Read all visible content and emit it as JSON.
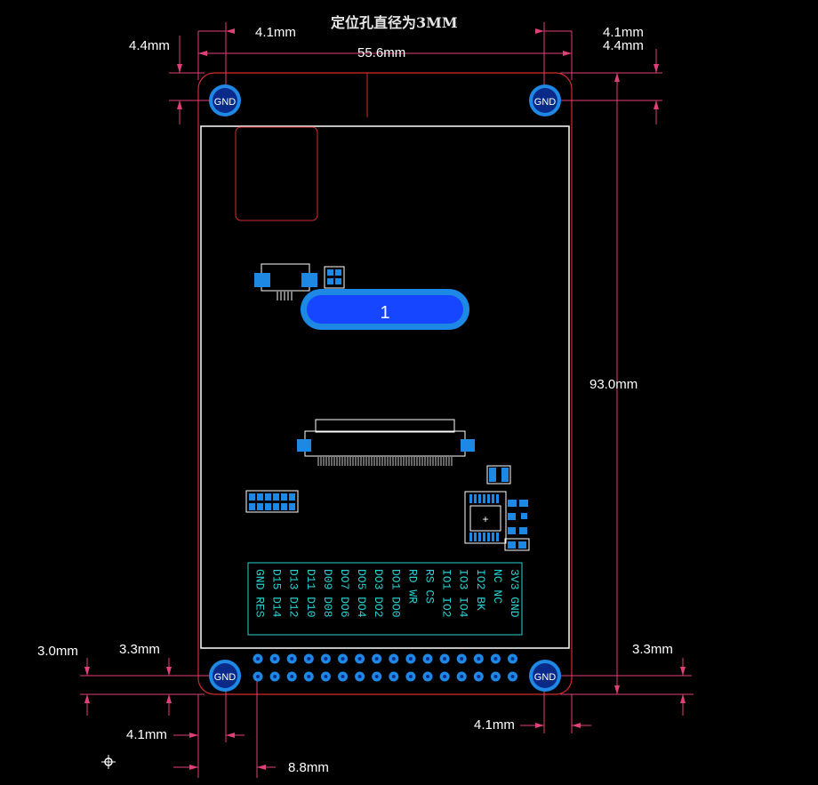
{
  "title": "定位孔直径为3MM",
  "dimensions": {
    "top_left_offset": "4.1mm",
    "top_left_height": "4.4mm",
    "width_total": "55.6mm",
    "top_right_offset": "4.1mm",
    "top_right_height": "4.4mm",
    "height_total": "93.0mm",
    "bottom_left_height": "3.0mm",
    "bottom_left_offset_y": "3.3mm",
    "bottom_right_offset_y": "3.3mm",
    "bottom_left_offset_x": "4.1mm",
    "bottom_right_offset_x": "4.1mm",
    "pin_offset": "8.8mm"
  },
  "mount_holes": [
    "GND",
    "GND",
    "GND",
    "GND"
  ],
  "connector_label": "1",
  "pin_labels": [
    "3V3 GND",
    "NC  NC",
    "IO2 BK",
    "IO3 IO4",
    "IO1 IO2",
    "RS  CS",
    "RD  WR",
    "DO1 DO0",
    "DO3 DO2",
    "DO5 DO4",
    "DO7 DO6",
    "D09 D08",
    "D11 D10",
    "D13 D12",
    "D15 D14",
    "GND RES"
  ],
  "colors": {
    "background": "#000000",
    "outline": "#d22c2c",
    "dimension_line": "#e0407a",
    "silkscreen": "#ffffff",
    "pad": "#1e88e5",
    "connector_fill": "#1646ff",
    "pin_text": "#2ad0d0"
  }
}
